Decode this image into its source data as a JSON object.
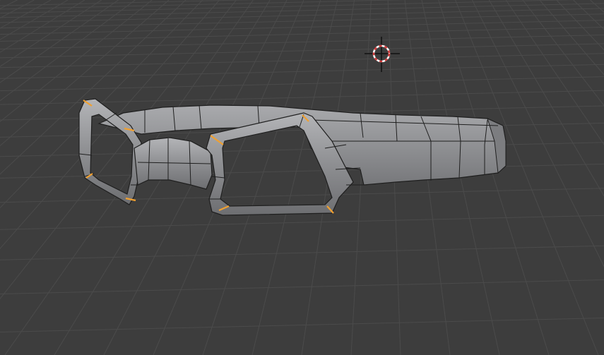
{
  "viewport": {
    "mode": "Edit Mode",
    "background_color": "#3d3d3d",
    "grid_color": "#4a4a4a",
    "mesh_color": "#8c8d90",
    "edge_color": "#1a1a1a",
    "selected_edge_color": "#f0a030"
  },
  "scene": {
    "object": "glasses-frame-mesh",
    "cursor_icon": "3d-cursor-icon"
  }
}
